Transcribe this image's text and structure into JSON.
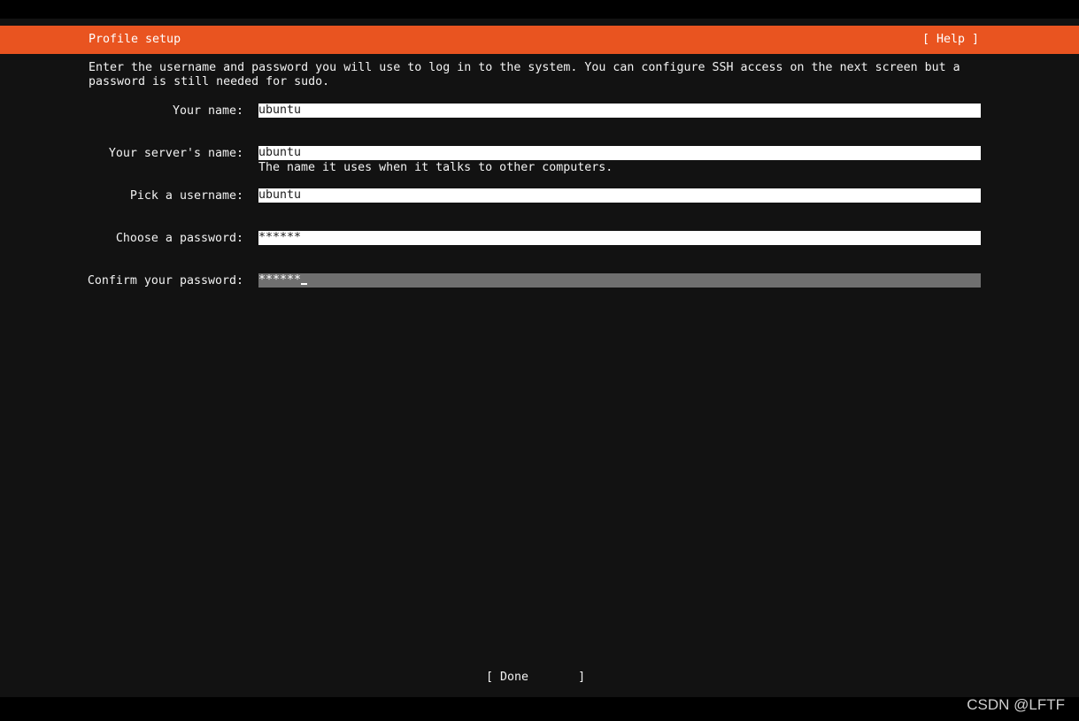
{
  "header": {
    "title": "Profile setup",
    "help_label": "[ Help ]"
  },
  "intro": "Enter the username and password you will use to log in to the system. You can configure SSH access on the next screen but a password is still needed for sudo.",
  "form": {
    "your_name": {
      "label": "Your name:",
      "value": "ubuntu"
    },
    "server_name": {
      "label": "Your server's name:",
      "value": "ubuntu",
      "help": "The name it uses when it talks to other computers."
    },
    "username": {
      "label": "Pick a username:",
      "value": "ubuntu"
    },
    "password": {
      "label": "Choose a password:",
      "value": "******"
    },
    "confirm_password": {
      "label": "Confirm your password:",
      "value": "******"
    }
  },
  "done_label": "[ Done       ]",
  "watermark": "CSDN @LFTF",
  "colors": {
    "accent": "#e95420",
    "background": "#121212",
    "frame": "#000000",
    "input_bg": "#ffffff",
    "input_focused_bg": "#6f6f6f"
  }
}
